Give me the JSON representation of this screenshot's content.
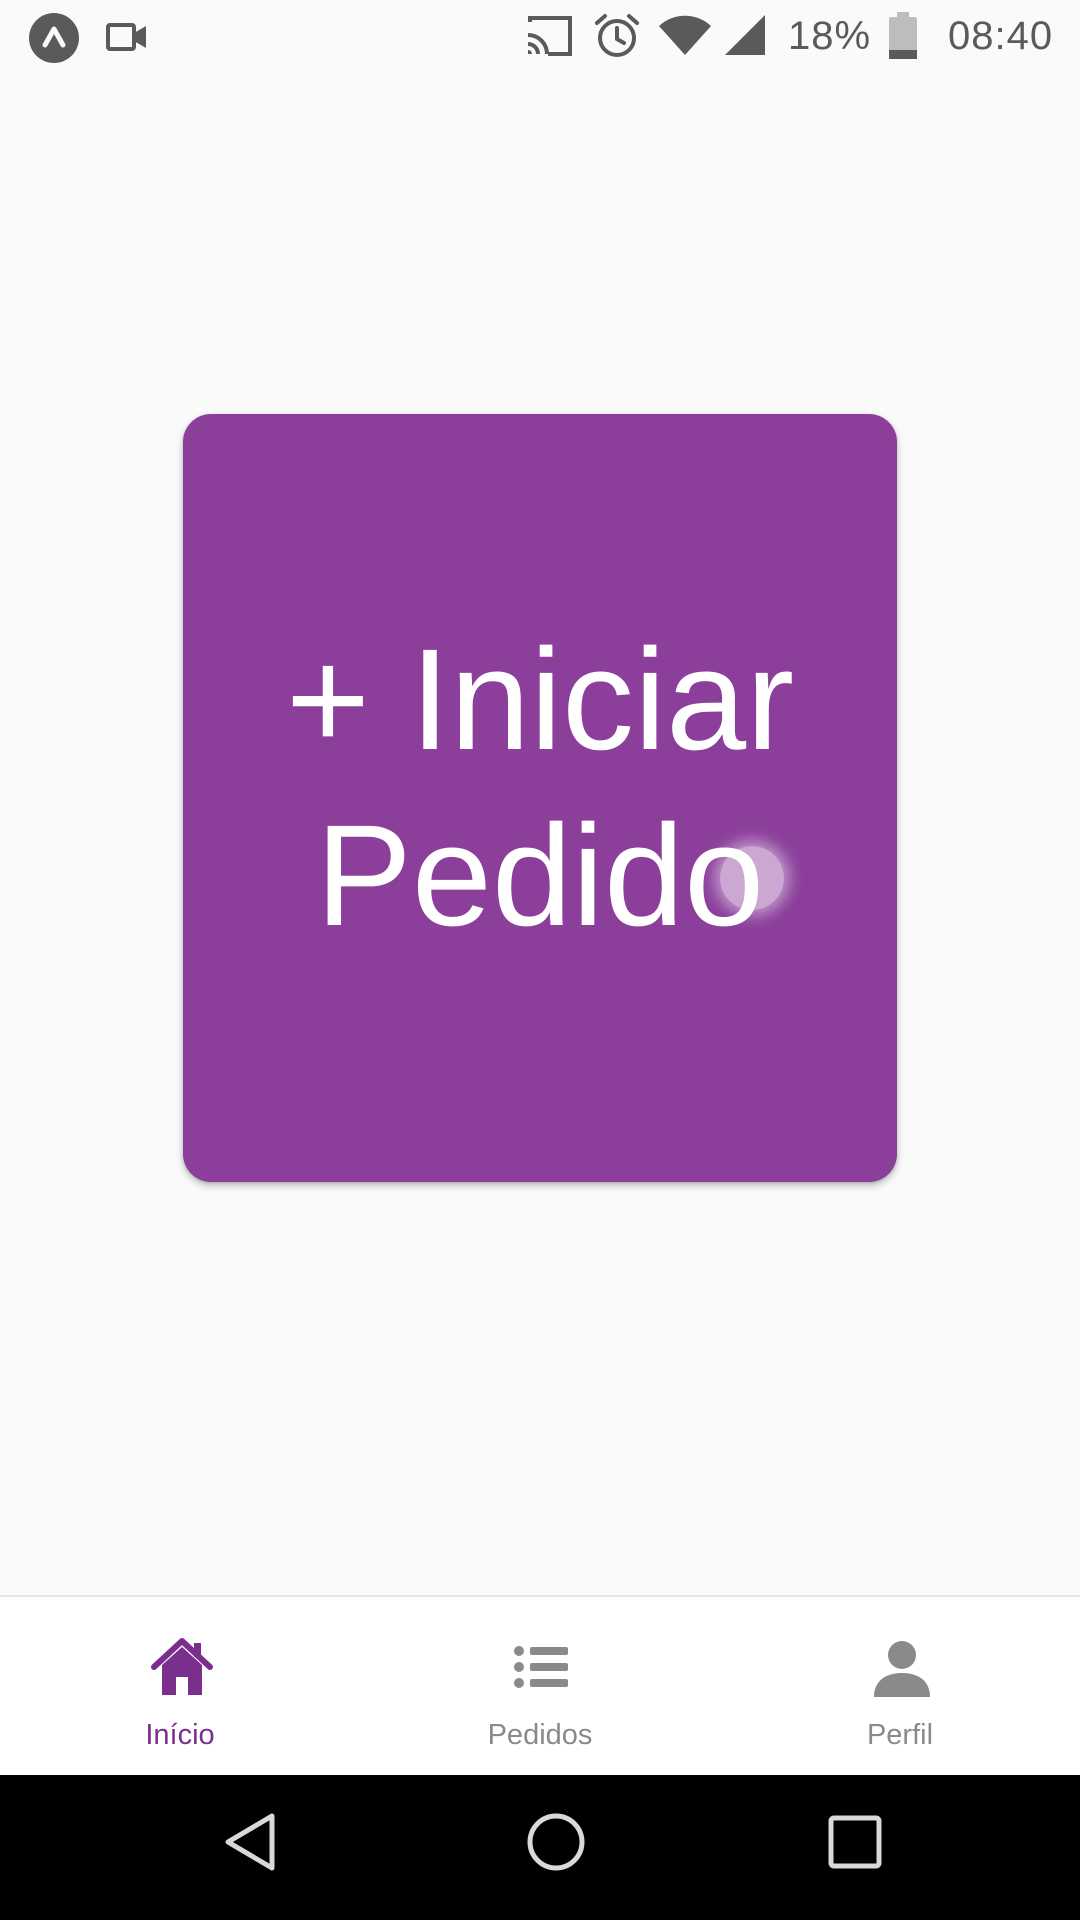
{
  "status_bar": {
    "icons": [
      "app-logo-icon",
      "video-record-icon",
      "cast-icon",
      "alarm-icon",
      "wifi-icon",
      "cell-signal-icon",
      "battery-icon"
    ],
    "battery_percent": "18%",
    "time": "08:40"
  },
  "main": {
    "start_order_button": {
      "label": "+ Iniciar Pedido",
      "color": "#8b3f9b"
    }
  },
  "bottom_nav": {
    "active": "Início",
    "active_color": "#7b2f8c",
    "items": [
      {
        "label": "Início",
        "icon": "home-icon"
      },
      {
        "label": "Pedidos",
        "icon": "list-icon"
      },
      {
        "label": "Perfil",
        "icon": "person-icon"
      }
    ]
  },
  "system_nav": {
    "buttons": [
      "back-icon",
      "home-circle-icon",
      "recents-icon"
    ]
  }
}
